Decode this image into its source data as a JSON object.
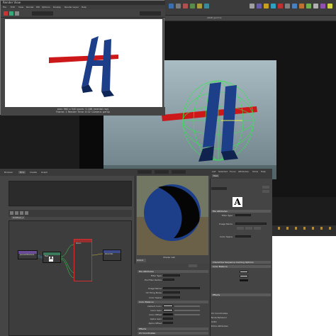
{
  "render_view": {
    "title": "Render View",
    "menu": [
      "File",
      "Edit",
      "View",
      "Render",
      "IPR",
      "Options",
      "Display",
      "Render Layer",
      "Help"
    ],
    "status_line": "size: 960 x 540 zoom: 0.188   (mental ray)",
    "status_line2": "Frame: 1    Render Time: 0:02    Camera: persp"
  },
  "viewport": {
    "panel_menu": [
      "View",
      "Shading",
      "Lighting",
      "Show",
      "Renderer",
      "Panels"
    ],
    "renderer_label": "sRGB gamma"
  },
  "hypershade": {
    "tabs": [
      "Browser",
      "Bins",
      "Create",
      "Graph"
    ],
    "node_editor_tab": "Untitled_1",
    "nodes": [
      {
        "name": "place2dTexture1",
        "color": "#6a4b9a"
      },
      {
        "name": "file1",
        "color": "#3c7a5c"
      },
      {
        "name": "blinn1",
        "color": "#9a2e2e"
      },
      {
        "name": "blinn1SG",
        "color": "#3e4b8a"
      }
    ]
  },
  "material_viewer": {
    "renderer": "Arnold",
    "shape": "Shader Ball",
    "env": "Lightbox",
    "bottom_label": "Shader ball",
    "node_label": "blinn1",
    "sections": [
      "File Attributes",
      "Color Balance",
      "Effects",
      "UV Coordinates"
    ],
    "props": [
      {
        "label": "Filter Type",
        "value": "Quadratic"
      },
      {
        "label": "Pre Filter",
        "value": ""
      },
      {
        "label": "Pre Filter Radius",
        "value": "2.000"
      },
      {
        "label": "Image Name",
        "value": "sourceimages/A_diffuse.tif"
      },
      {
        "label": "UV Tiling Mode",
        "value": "Off"
      },
      {
        "label": "Color Space",
        "value": "sRGB"
      },
      {
        "label": "Default Color",
        "value": ""
      },
      {
        "label": "Color Gain",
        "value": ""
      },
      {
        "label": "Color Offset",
        "value": ""
      },
      {
        "label": "Alpha Gain",
        "value": "1.000"
      },
      {
        "label": "Alpha Offset",
        "value": "0.000"
      }
    ]
  },
  "attribute_editor": {
    "tabs": [
      "List",
      "Selected",
      "Focus",
      "Attributes",
      "Show",
      "Help"
    ],
    "node_tab": "file1",
    "swatch_letter": "A",
    "section_title": "File Attributes",
    "filter_label": "Filter Type",
    "filter_value": "Quadratic",
    "image_label": "Image Name",
    "image_value": "sourceimages/A_diffuse.tif",
    "buttons": [
      "Reload",
      "Edit",
      "View"
    ],
    "color_space_label": "Color Space",
    "color_space_value": "sRGB",
    "section2": "Interactive Sequence Caching Options",
    "section3": "Color Balance",
    "section4": "Effects",
    "bottom_links": [
      "UV Coordinates",
      "Node Behavior",
      "UUID",
      "Extra Attributes"
    ]
  },
  "colors": {
    "accent_red": "#cc1818",
    "object_blue": "#1d3f8a",
    "wire_green": "#2eea4e",
    "selected_node": "#d23030"
  }
}
